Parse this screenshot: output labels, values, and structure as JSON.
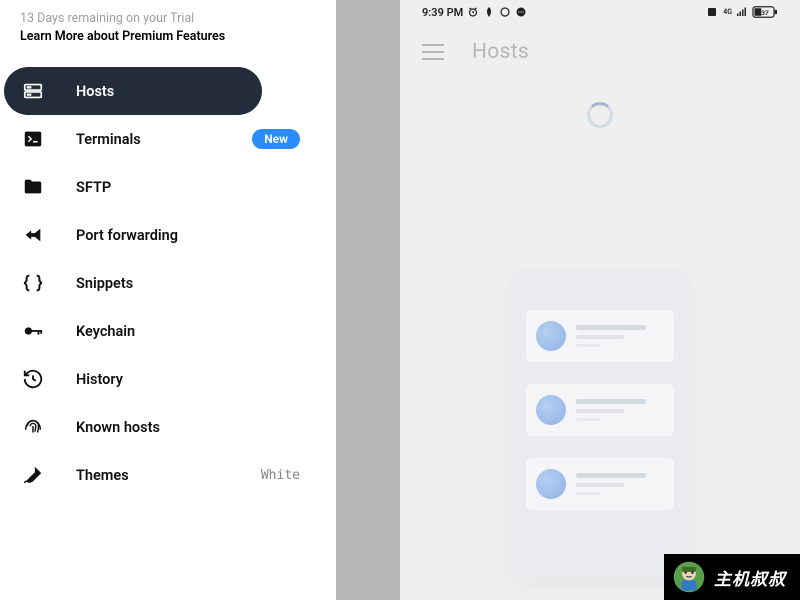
{
  "trial": {
    "line1": "13 Days remaining on your Trial",
    "line2": "Learn More about Premium Features"
  },
  "nav": {
    "hosts": "Hosts",
    "terminals": "Terminals",
    "terminals_badge": "New",
    "sftp": "SFTP",
    "portfwd": "Port forwarding",
    "snippets": "Snippets",
    "keychain": "Keychain",
    "history": "History",
    "knownhosts": "Known hosts",
    "themes": "Themes",
    "themes_value": "White"
  },
  "statusbar": {
    "time": "9:39 PM",
    "battery": "37"
  },
  "appbar": {
    "title": "Hosts"
  },
  "corner_badge": {
    "text": "主机叔叔"
  }
}
